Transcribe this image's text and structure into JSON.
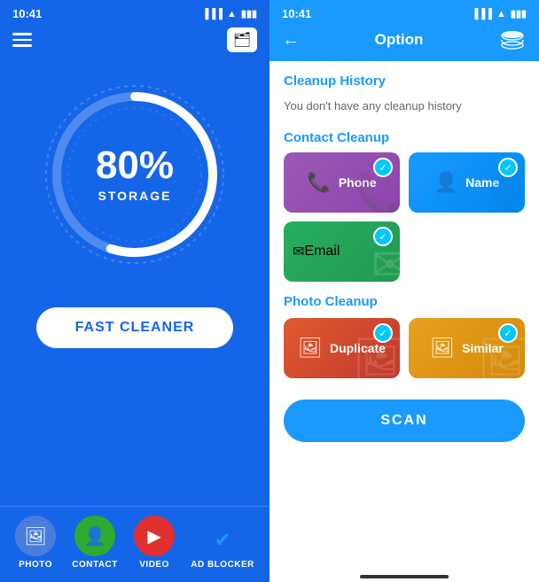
{
  "left": {
    "status_time": "10:41",
    "storage_percent": "80%",
    "storage_label": "STORAGE",
    "fast_cleaner_btn": "FAST CLEANER",
    "nav_items": [
      {
        "id": "photo",
        "label": "PHOTO",
        "icon": "🖼"
      },
      {
        "id": "contact",
        "label": "CONTACT",
        "icon": "👤"
      },
      {
        "id": "video",
        "label": "VIDEO",
        "icon": "▶"
      }
    ],
    "ad_blocker_label": "AD BLOCKER"
  },
  "right": {
    "status_time": "10:41",
    "option_title": "Option",
    "cleanup_history_title": "Cleanup History",
    "cleanup_history_empty": "You don't have any cleanup history",
    "contact_cleanup_title": "Contact Cleanup",
    "contact_cards": [
      {
        "id": "phone",
        "label": "Phone",
        "icon": "📞"
      },
      {
        "id": "name",
        "label": "Name",
        "icon": "👤"
      }
    ],
    "email_card": {
      "id": "email",
      "label": "Email",
      "icon": "✉"
    },
    "photo_cleanup_title": "Photo Cleanup",
    "photo_cards": [
      {
        "id": "duplicate",
        "label": "Duplicate",
        "icon": "🖼"
      },
      {
        "id": "similar",
        "label": "Similar",
        "icon": "🖼"
      }
    ],
    "scan_btn": "SCAN"
  }
}
